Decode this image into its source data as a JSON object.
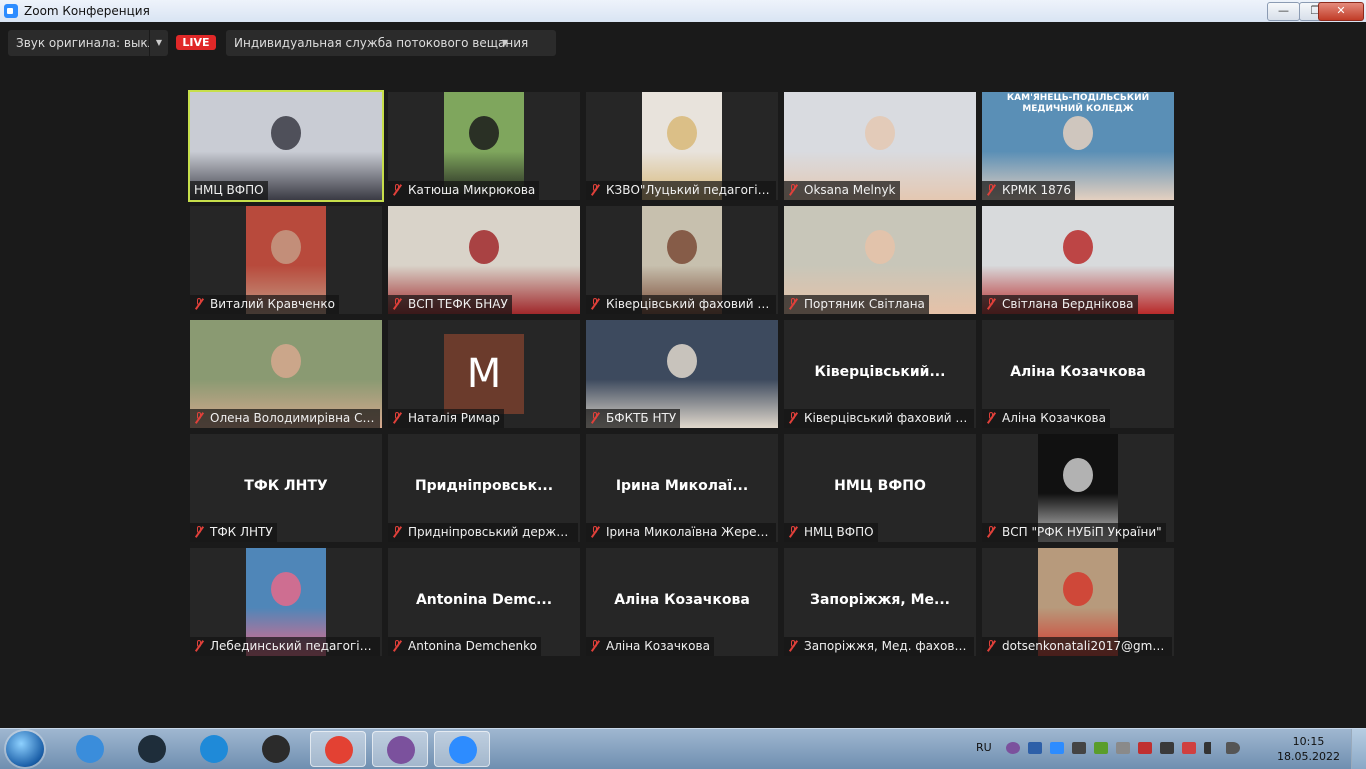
{
  "window": {
    "title": "Zoom Конференция",
    "controls": {
      "minimize": "—",
      "maximize": "❐",
      "close": "✕"
    }
  },
  "toolbar": {
    "original_sound": "Звук оригинала: выкл.",
    "live": "LIVE",
    "streaming_service": "Индивидуальная служба потокового вещания"
  },
  "tiles": [
    {
      "name": "НМЦ ВФПО",
      "mode": "video",
      "muted": false,
      "active": true,
      "bg": "#c9ccd4",
      "accent": "#3a3a44"
    },
    {
      "name": "Катюша Микрюкова",
      "mode": "video",
      "muted": true,
      "bg": "#7fa65d",
      "accent": "#1b1b1b",
      "narrow": true
    },
    {
      "name": "КЗВО\"Луцький педагогічн...",
      "mode": "video",
      "muted": true,
      "bg": "#e8e3dc",
      "accent": "#d8b878",
      "narrow": true
    },
    {
      "name": "Oksana Melnyk",
      "mode": "video",
      "muted": true,
      "bg": "#d9dbe0",
      "accent": "#e4c8b2"
    },
    {
      "name": "КРМК 1876",
      "mode": "video",
      "muted": true,
      "bg": "#5a8fb6",
      "accent": "#e4d0c0",
      "banner": "КАМ'ЯНЕЦЬ-ПОДІЛЬСЬКИЙ МЕДИЧНИЙ КОЛЕДЖ"
    },
    {
      "name": "Виталий Кравченко",
      "mode": "video",
      "muted": true,
      "bg": "#b84a3c",
      "accent": "#c49a84",
      "narrow": true
    },
    {
      "name": "ВСП ТЕФК БНАУ",
      "mode": "video",
      "muted": true,
      "bg": "#d9d3c9",
      "accent": "#a0282b"
    },
    {
      "name": "Ківерцівський фаховий ме...",
      "mode": "video",
      "muted": true,
      "bg": "#c7c0ae",
      "accent": "#7a4a36",
      "narrow": true
    },
    {
      "name": "Портяник Світлана",
      "mode": "video",
      "muted": true,
      "bg": "#c8c6b9",
      "accent": "#e6c2a8"
    },
    {
      "name": "Світлана Берднікова",
      "mode": "video",
      "muted": true,
      "bg": "#d8dadc",
      "accent": "#b82a2a"
    },
    {
      "name": "Олена Володимирівна Со...",
      "mode": "video",
      "muted": true,
      "bg": "#8a9a72",
      "accent": "#d6a88e"
    },
    {
      "name": "Наталія Римар",
      "mode": "avatar",
      "initial": "M",
      "muted": true
    },
    {
      "name": "БФКТБ НТУ",
      "mode": "video",
      "muted": true,
      "bg": "#3d4a5e",
      "accent": "#e0d8cc"
    },
    {
      "name": "Ківерцівський фаховий ме...",
      "display": "Ківерцівський...",
      "mode": "name",
      "muted": true
    },
    {
      "name": "Аліна Козачкова",
      "display": "Аліна Козачкова",
      "mode": "name",
      "muted": true
    },
    {
      "name": "ТФК ЛНТУ",
      "display": "ТФК ЛНТУ",
      "mode": "name",
      "muted": true
    },
    {
      "name": "Придніпровський держав...",
      "display": "Придніпровськ...",
      "mode": "name",
      "muted": true
    },
    {
      "name": "Ірина Миколаївна Жеревч...",
      "display": "Ірина  Миколаї...",
      "mode": "name",
      "muted": true
    },
    {
      "name": "НМЦ ВФПО",
      "display": "НМЦ ВФПО",
      "mode": "name",
      "muted": true
    },
    {
      "name": "ВСП \"РФК НУБіП України\"",
      "mode": "video",
      "muted": true,
      "bg": "#111111",
      "accent": "#cfcfcf",
      "narrow": true
    },
    {
      "name": "Лебединський педагогічн...",
      "mode": "video",
      "muted": true,
      "bg": "#4f86b8",
      "accent": "#e46a8a",
      "narrow": true
    },
    {
      "name": "Antonina Demchenko",
      "display": "Antonina  Demc...",
      "mode": "name",
      "muted": true
    },
    {
      "name": "Аліна Козачкова",
      "display": "Аліна Козачкова",
      "mode": "name",
      "muted": true
    },
    {
      "name": "Запоріжжя, Мед. фаховий...",
      "display": "Запоріжжя,  Ме...",
      "mode": "name",
      "muted": true
    },
    {
      "name": "dotsenkonatali2017@gmail...",
      "mode": "video",
      "muted": true,
      "bg": "#b79a7c",
      "accent": "#d33a2e",
      "narrow": true
    }
  ],
  "taskbar": {
    "apps": [
      {
        "name": "internet-explorer",
        "color": "#3a8ddb",
        "active": false
      },
      {
        "name": "media-player",
        "color": "#1e2d3a",
        "active": false
      },
      {
        "name": "edge",
        "color": "#1f8ad8",
        "active": false
      },
      {
        "name": "scanner",
        "color": "#2b2b2b",
        "active": false
      },
      {
        "name": "chrome",
        "color": "#e34133",
        "active": true
      },
      {
        "name": "viber",
        "color": "#7b519d",
        "active": true
      },
      {
        "name": "zoom",
        "color": "#2d8cff",
        "active": true
      }
    ],
    "language": "RU",
    "time": "10:15",
    "date": "18.05.2022"
  }
}
